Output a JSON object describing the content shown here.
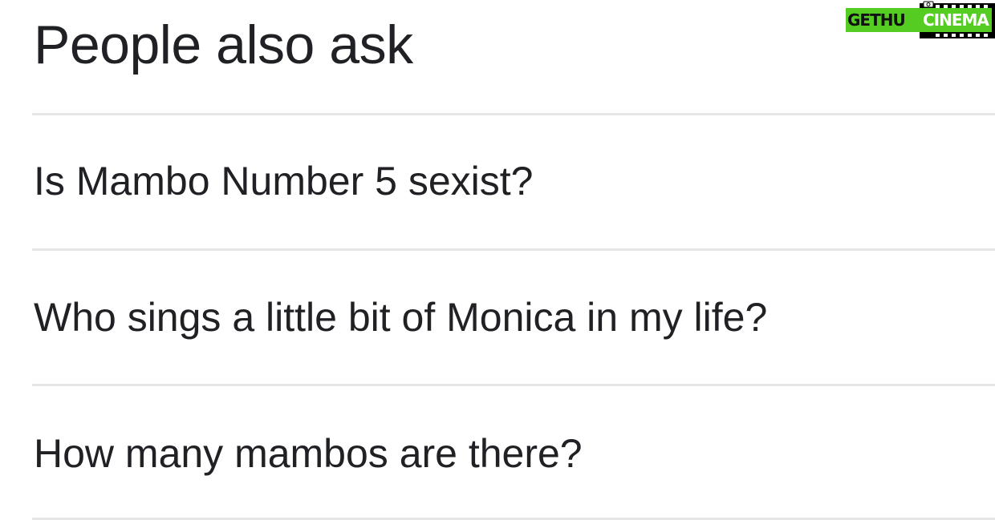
{
  "section": {
    "title": "People also ask"
  },
  "questions": [
    {
      "text": "Is Mambo Number 5 sexist?"
    },
    {
      "text": "Who sings a little bit of Monica in my life?"
    },
    {
      "text": "How many mambos are there?"
    }
  ],
  "watermark": {
    "text_left": "GETHU",
    "text_right": "CINEMA"
  },
  "colors": {
    "text": "#202124",
    "divider": "#e6e6e6",
    "watermark_green": "#55cc22"
  }
}
